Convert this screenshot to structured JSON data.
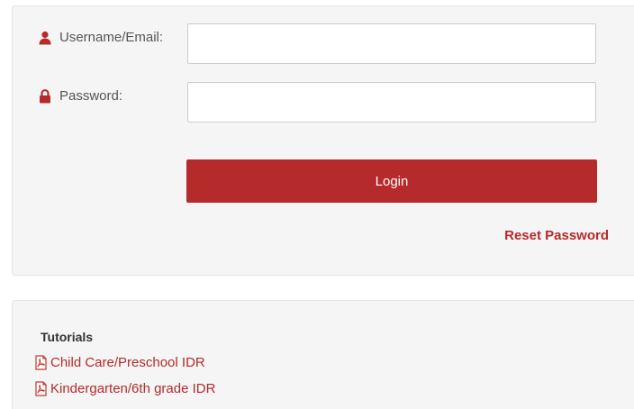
{
  "login": {
    "username_label": "Username/Email:",
    "username_value": "",
    "username_placeholder": "",
    "password_label": "Password:",
    "password_value": "",
    "password_placeholder": "",
    "login_button_label": "Login",
    "reset_password_label": "Reset Password"
  },
  "tutorials": {
    "heading": "Tutorials",
    "items": [
      {
        "label": "Child Care/Preschool IDR",
        "icon": "pdf-icon"
      },
      {
        "label": "Kindergarten/6th grade IDR",
        "icon": "pdf-icon"
      }
    ]
  },
  "colors": {
    "accent": "#b52a2a",
    "panel_background": "#f5f5f5",
    "label_text": "#555555"
  },
  "icons": {
    "username": "user-icon",
    "password": "lock-icon"
  }
}
